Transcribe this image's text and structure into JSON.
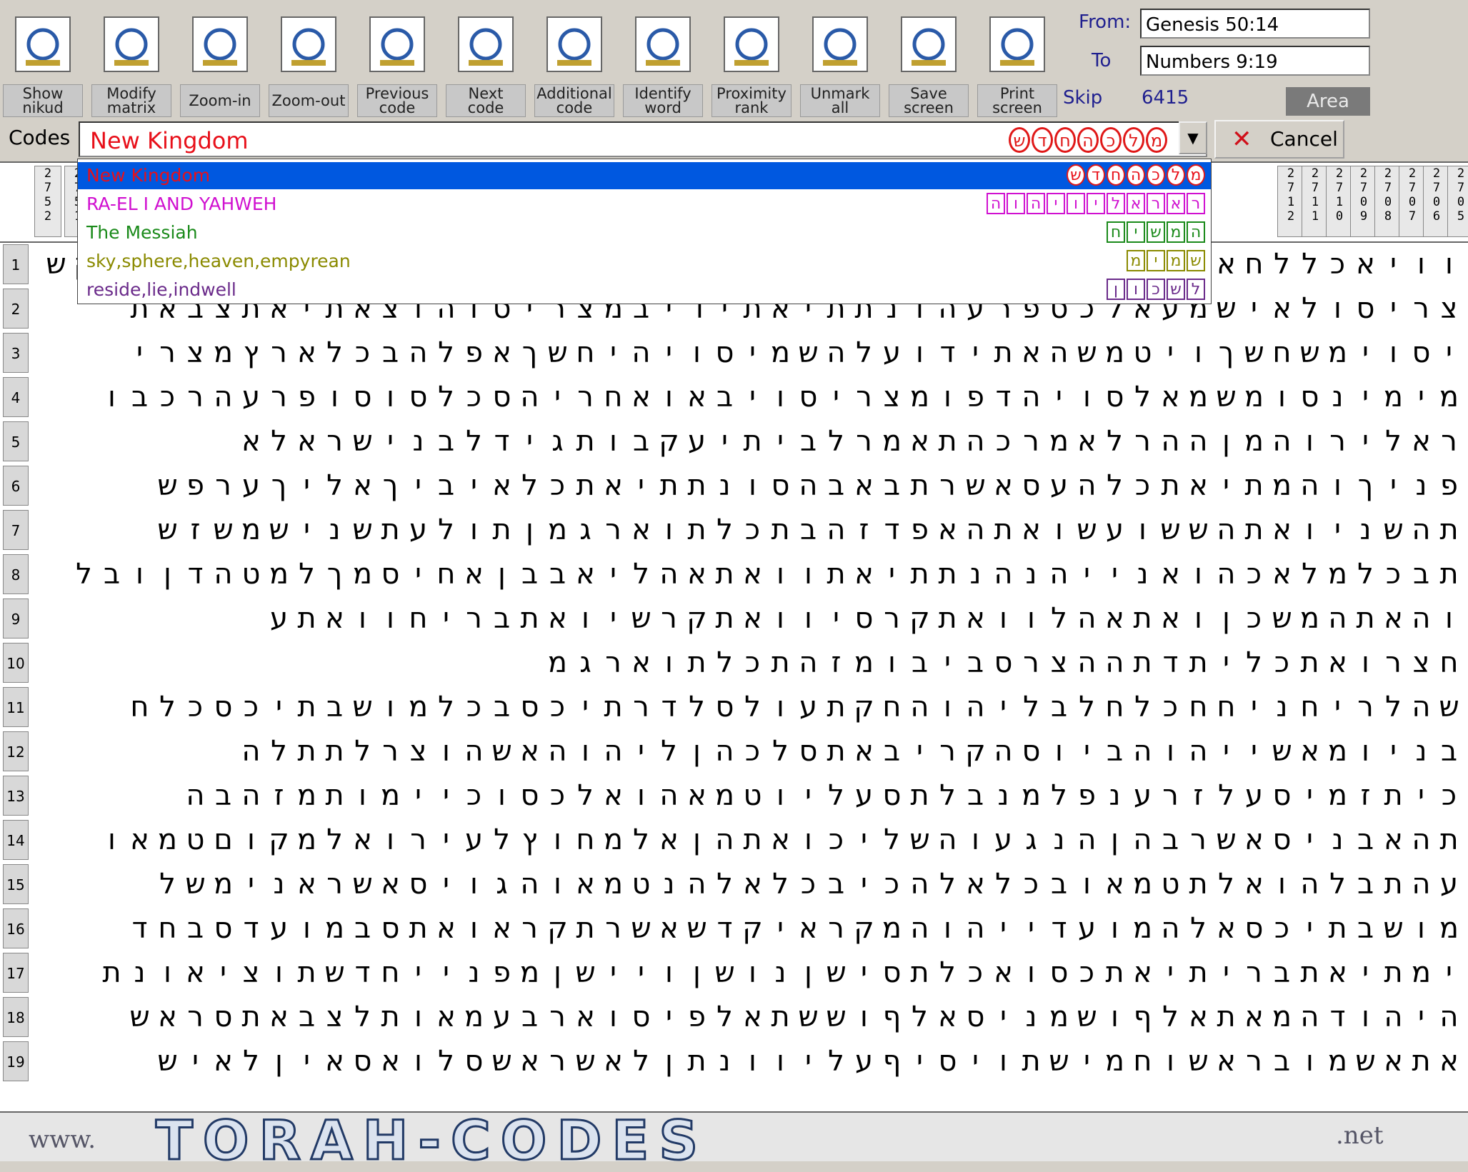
{
  "toolbar": {
    "buttons": [
      {
        "id": "show-nikud",
        "label": "Show\nnikud",
        "icon": "nikud-icon"
      },
      {
        "id": "modify-matrix",
        "label": "Modify\nmatrix",
        "icon": "matrix-icon"
      },
      {
        "id": "zoom-in",
        "label": "Zoom-in",
        "icon": "zoom-in-icon"
      },
      {
        "id": "zoom-out",
        "label": "Zoom-out",
        "icon": "zoom-out-icon"
      },
      {
        "id": "previous-code",
        "label": "Previous\ncode",
        "icon": "previous-arrow-icon"
      },
      {
        "id": "next-code",
        "label": "Next\ncode",
        "icon": "next-arrow-icon"
      },
      {
        "id": "additional-code",
        "label": "Additional\ncode",
        "icon": "additional-code-icon"
      },
      {
        "id": "identify-word",
        "label": "Identify\nword",
        "icon": "identify-word-icon"
      },
      {
        "id": "proximity-rank",
        "label": "Proximity\nrank",
        "icon": "proximity-icon"
      },
      {
        "id": "unmark-all",
        "label": "Unmark\nall",
        "icon": "unmark-icon"
      },
      {
        "id": "save-screen",
        "label": "Save\nscreen",
        "icon": "save-disk-icon"
      },
      {
        "id": "print-screen",
        "label": "Print\nscreen",
        "icon": "printer-icon"
      }
    ]
  },
  "range": {
    "from_label": "From:",
    "from_value": "Genesis 50:14",
    "to_label": "To",
    "to_value": "Numbers 9:19",
    "skip_label": "Skip",
    "skip_value": "6415",
    "area_label": "Area"
  },
  "codes": {
    "label": "Codes :",
    "value": "New Kingdom",
    "value_letters": [
      "ש",
      "ד",
      "ח",
      "ה",
      "כ",
      "ל",
      "מ"
    ],
    "cancel_label": "Cancel",
    "dropdown_arrow": "▼"
  },
  "dropdown": [
    {
      "name": "New Kingdom",
      "color": "#e8101a",
      "letters": [
        "ש",
        "ד",
        "ח",
        "ה",
        "כ",
        "ל",
        "מ"
      ],
      "selected": true
    },
    {
      "name": "RA-EL I AND YAHWEH",
      "color": "#d010d0",
      "letters": [
        "ה",
        "ו",
        "ה",
        "י",
        "ו",
        "י",
        "ל",
        "א",
        "ר",
        "א",
        "ר"
      ],
      "selected": false
    },
    {
      "name": "The Messiah",
      "color": "#1a8a1a",
      "letters": [
        "ח",
        "י",
        "ש",
        "מ",
        "ה"
      ],
      "selected": false
    },
    {
      "name": "sky,sphere,heaven,empyrean",
      "color": "#8a8a00",
      "letters": [
        "מ",
        "י",
        "מ",
        "ש"
      ],
      "selected": false
    },
    {
      "name": "reside,lie,indwell",
      "color": "#6a2a8a",
      "letters": [
        "ן",
        "ו",
        "כ",
        "ש",
        "ל"
      ],
      "selected": false
    }
  ],
  "column_headers": [
    [
      "2",
      "7",
      "5",
      "2"
    ],
    [
      "2",
      "7",
      "5",
      "1"
    ],
    [
      "2",
      "7",
      "1",
      "2"
    ],
    [
      "2",
      "7",
      "1",
      "1"
    ],
    [
      "2",
      "7",
      "1",
      "0"
    ],
    [
      "2",
      "7",
      "0",
      "9"
    ],
    [
      "2",
      "7",
      "0",
      "8"
    ],
    [
      "2",
      "7",
      "0",
      "7"
    ],
    [
      "2",
      "7",
      "0",
      "6"
    ],
    [
      "2",
      "7",
      "0",
      "5"
    ]
  ],
  "matrix_rows": [
    "וויאכללחאלכלואהלאיכרמשאבלשולשויאכללחהקרבהיטמושדחתקשאיללכמושכירבההאייומקרמשמויכויאכללחיו",
    "צריסולאישמעאלכספרעהונתתיאתידיבמצריסוהוצאתיאתצבאת",
    "יסוימשחשךויטמשהאתידועלהשמיסויהיחשךאפלהבכלארץמצרי",
    "מימינסומשמאלסויהדפומצריסויבאואחריהסכלסוסופרעהרכבו",
    "ראלירוהמןההרלאמרכהתאמרלביתיעקבותגידלבנישראלא",
    "פניךוהמתיאתכלהעסאשרתבאבהסונתתיאתכלאיביךאליךערפש",
    "תהשניואתהששועשואתהאפדזהבתכלתוארגמןתולעתשנישמשזש",
    "תבכלמלאכהואנייהנהנתתיאתוואתאהליאבבןאחיסמךלמטהדןובל",
    "והאתהמשכןואתאהלוואתקרסיוואתקרשיואתבריחוואתע",
    "חצרואתכליתדתההצרסביבומזהתכלתוארגמ",
    "שהלריחניחחכלחלבליהוהחקתעולסלדרתיכסבכלמושבתיכסכלח",
    "בניומאשייהוהביוסהקריבאתסלכהןליהוהאשהוצרלתתלה",
    "כיתזמיסעלזרענפלמנבלתסעליוטמאהואלכסוכיימותמזהבה",
    "תהאבניסאשרבהןהנגעוהשליכואתהןאלמחוץלעירואלמקוםטמאו",
    "עהתבלהואלתטמאובכלאלהכיבכלאלהנטמאוהגויסאשראנימשל",
    "מושבתיכסאלהמועדייהוהמקראיקדשאשרתקראואתסבמועדסבחד",
    "ימתיאתבריתיאתכסואכלתסישןנושןויישןמפנייחדשתוציאונת",
    "היהודהמאתאלףושמניסאלףוששתאלפיסוארבעמאותלצבאתסראש",
    "אתאשמובראשוחמישתויסיףעליוונתןלאשראשסלואסאיןלאיש"
  ],
  "footer": {
    "www": "www.",
    "brand": "TORAH-CODES",
    ".net": ".net"
  }
}
